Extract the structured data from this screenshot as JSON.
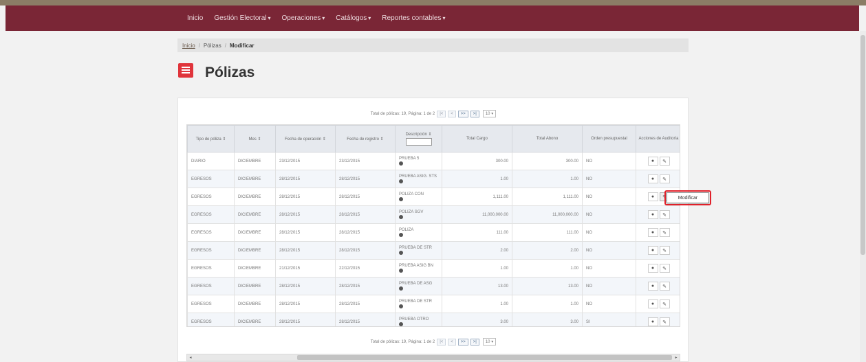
{
  "nav": {
    "items": [
      {
        "label": "Inicio",
        "caret": false
      },
      {
        "label": "Gestión Electoral",
        "caret": true
      },
      {
        "label": "Operaciones",
        "caret": true
      },
      {
        "label": "Catálogos",
        "caret": true
      },
      {
        "label": "Reportes contables",
        "caret": true
      }
    ],
    "bar_color": "#7a2636"
  },
  "breadcrumb": {
    "home": "Inicio",
    "section": "Pólizas",
    "current": "Modificar",
    "separator": "/"
  },
  "page": {
    "title": "Pólizas",
    "icon": "list-icon",
    "accent": "#e0343b"
  },
  "pager": {
    "top_text": "Total de pólizas: 19, Página: 1 de 2",
    "bottom_text": "Total de pólizas: 19, Página: 1 de 2",
    "buttons": [
      "|<",
      "<",
      ">>",
      ">|"
    ],
    "page_size": "10"
  },
  "table": {
    "columns": [
      "Tipo de póliza",
      "Mes",
      "Fecha de operación",
      "Fecha de registro",
      "Descripción",
      "Total Cargo",
      "Total Abono",
      "Orden presupuestal",
      "Acciones de Auditoría"
    ],
    "rows": [
      {
        "tipo": "DIARIO",
        "mes": "DICIEMBRE",
        "fecha_op": "23/12/2015",
        "fecha_reg": "23/12/2015",
        "descripcion": "PRUEBA 5",
        "cargo": "300.00",
        "abono": "300.00",
        "orden": "NO"
      },
      {
        "tipo": "EGRESOS",
        "mes": "DICIEMBRE",
        "fecha_op": "28/12/2015",
        "fecha_reg": "28/12/2015",
        "descripcion": "PRUEBA ASIG. STS",
        "cargo": "1.00",
        "abono": "1.00",
        "orden": "NO"
      },
      {
        "tipo": "EGRESOS",
        "mes": "DICIEMBRE",
        "fecha_op": "28/12/2015",
        "fecha_reg": "28/12/2015",
        "descripcion": "POLIZA CON",
        "cargo": "1,111.00",
        "abono": "1,111.00",
        "orden": "NO"
      },
      {
        "tipo": "EGRESOS",
        "mes": "DICIEMBRE",
        "fecha_op": "28/12/2015",
        "fecha_reg": "28/12/2015",
        "descripcion": "POLIZA SGV",
        "cargo": "11,000,000.00",
        "abono": "11,000,000.00",
        "orden": "NO"
      },
      {
        "tipo": "EGRESOS",
        "mes": "DICIEMBRE",
        "fecha_op": "28/12/2015",
        "fecha_reg": "28/12/2015",
        "descripcion": "POLIZA",
        "cargo": "111.00",
        "abono": "111.00",
        "orden": "NO"
      },
      {
        "tipo": "EGRESOS",
        "mes": "DICIEMBRE",
        "fecha_op": "28/12/2015",
        "fecha_reg": "28/12/2015",
        "descripcion": "PRUEBA DE STR",
        "cargo": "2.00",
        "abono": "2.00",
        "orden": "NO"
      },
      {
        "tipo": "EGRESOS",
        "mes": "DICIEMBRE",
        "fecha_op": "21/12/2015",
        "fecha_reg": "22/12/2015",
        "descripcion": "PRUEBA ASIG BN",
        "cargo": "1.00",
        "abono": "1.00",
        "orden": "NO"
      },
      {
        "tipo": "EGRESOS",
        "mes": "DICIEMBRE",
        "fecha_op": "28/12/2015",
        "fecha_reg": "28/12/2015",
        "descripcion": "PRUEBA DE ASG",
        "cargo": "13.00",
        "abono": "13.00",
        "orden": "NO"
      },
      {
        "tipo": "EGRESOS",
        "mes": "DICIEMBRE",
        "fecha_op": "28/12/2015",
        "fecha_reg": "28/12/2015",
        "descripcion": "PRUEBA DE STR",
        "cargo": "1.00",
        "abono": "1.00",
        "orden": "NO"
      },
      {
        "tipo": "EGRESOS",
        "mes": "DICIEMBRE",
        "fecha_op": "28/12/2015",
        "fecha_reg": "28/12/2015",
        "descripcion": "PRUEBA OTRO",
        "cargo": "3.00",
        "abono": "3.00",
        "orden": "SI"
      }
    ]
  },
  "actions": {
    "view_icon": "eye-icon",
    "edit_icon": "pencil-icon"
  },
  "tooltip": {
    "text": "Modificar"
  },
  "scrollbars": {
    "left_arrow": "◂",
    "right_arrow": "▸"
  }
}
